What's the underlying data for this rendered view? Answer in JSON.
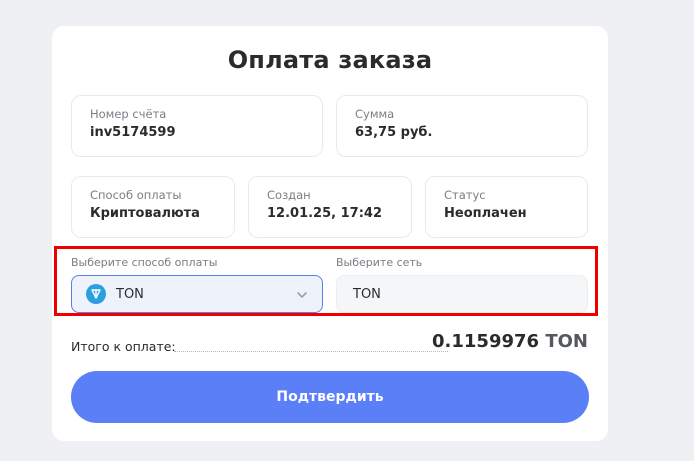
{
  "page": {
    "title": "Оплата заказа"
  },
  "info": {
    "invoice_label": "Номер счёта",
    "invoice_value": "inv5174599",
    "sum_label": "Сумма",
    "sum_value": "63,75 руб.",
    "method_label": "Способ оплаты",
    "method_value": "Криптовалюта",
    "created_label": "Создан",
    "created_value": "12.01.25, 17:42",
    "status_label": "Статус",
    "status_value": "Неоплачен"
  },
  "selection": {
    "method_field_label": "Выберите способ оплаты",
    "method_selected": "TON",
    "method_icon": "ton-icon",
    "network_field_label": "Выберите сеть",
    "network_value": "TON"
  },
  "total": {
    "label": "Итого к оплате:",
    "amount": "0.1159976",
    "currency": "TON"
  },
  "confirm_button": {
    "label": "Подтвердить"
  },
  "colors": {
    "accent": "#5b7ff7",
    "highlight": "#ee0000",
    "ton": "#2aa0e0"
  }
}
